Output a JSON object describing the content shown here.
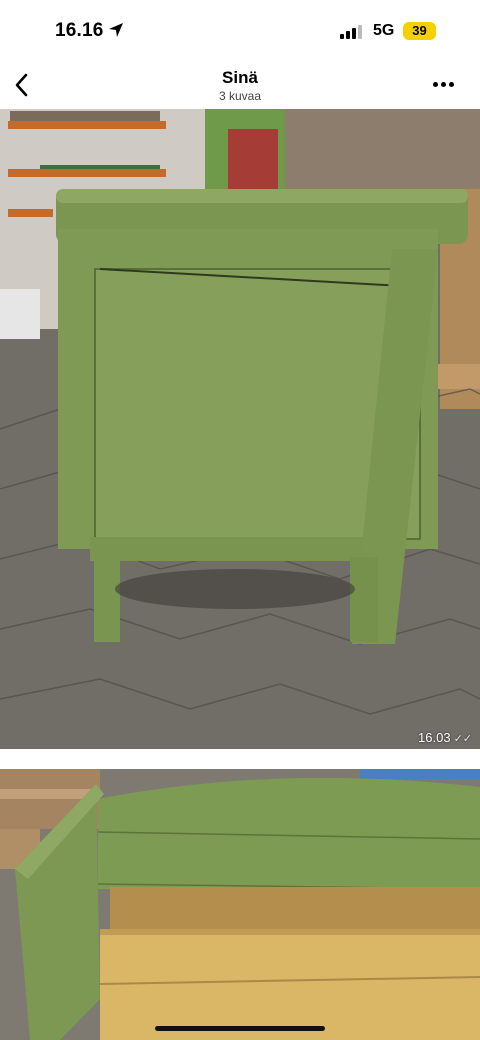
{
  "status_bar": {
    "time": "16.16",
    "network": "5G",
    "battery": "39",
    "battery_color": "#f5d000"
  },
  "header": {
    "title": "Sinä",
    "subtitle": "3 kuvaa"
  },
  "icons": {
    "back": "chevron-left-icon",
    "more": "more-dots-icon",
    "location": "location-arrow-icon",
    "signal": "signal-icon",
    "read_receipt": "double-check-icon"
  },
  "messages": [
    {
      "type": "photo",
      "description_icon": "photo",
      "time": "16.03"
    },
    {
      "type": "photo"
    }
  ],
  "colors": {
    "furniture_green": "#7e9a55",
    "floor_gray": "#6b6862"
  }
}
